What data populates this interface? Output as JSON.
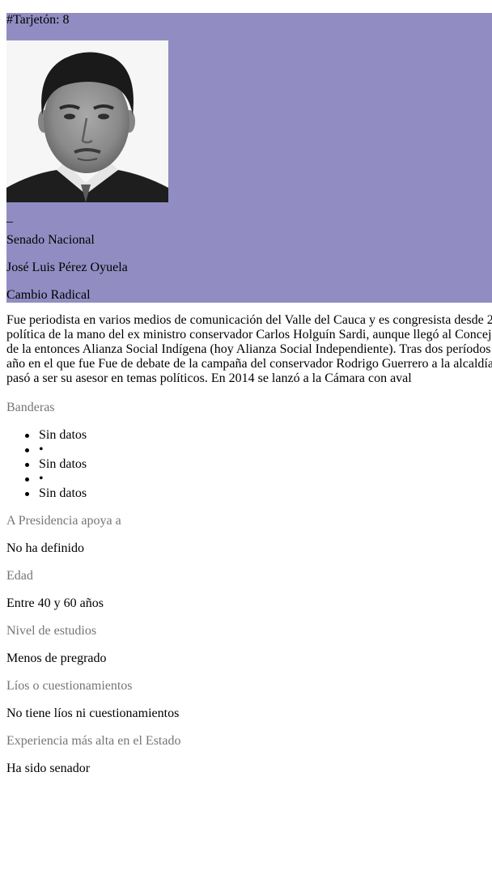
{
  "header": {
    "ballot_label": "#Tarjetón: 8",
    "separator": "_",
    "chamber": "Senado Nacional",
    "name": "José Luis Pérez Oyuela",
    "party": "Cambio Radical",
    "background_color": "#918dc2"
  },
  "bio": {
    "lines": [
      "Fue periodista en varios medios de comunicación del Valle del Cauca y es congresista desde 2",
      "política de la mano del ex ministro conservador Carlos Holguín Sardi, aunque llegó al Concej",
      "de la entonces Alianza Social Indígena (hoy Alianza Social Independiente). Tras dos períodos",
      "año en el que fue Fue de debate de la campaña del conservador Rodrigo Guerrero a la alcaldía",
      "pasó a ser su asesor en temas políticos. En 2014 se lanzó a la Cámara con aval"
    ]
  },
  "flags": {
    "label": "Banderas",
    "items": [
      "Sin datos",
      "•",
      "Sin datos",
      "•",
      "Sin datos"
    ]
  },
  "sections": {
    "presidency_label": "A Presidencia apoya a",
    "presidency_value": "No ha definido",
    "age_label": "Edad",
    "age_value": "Entre 40 y 60 años",
    "education_label": "Nivel de estudios",
    "education_value": "Menos de pregrado",
    "issues_label": "Líos o cuestionamientos",
    "issues_value": "No tiene líos ni cuestionamientos",
    "experience_label": "Experiencia más alta en el Estado",
    "experience_value": "Ha sido senador"
  },
  "colors": {
    "label_gray": "#757575"
  }
}
